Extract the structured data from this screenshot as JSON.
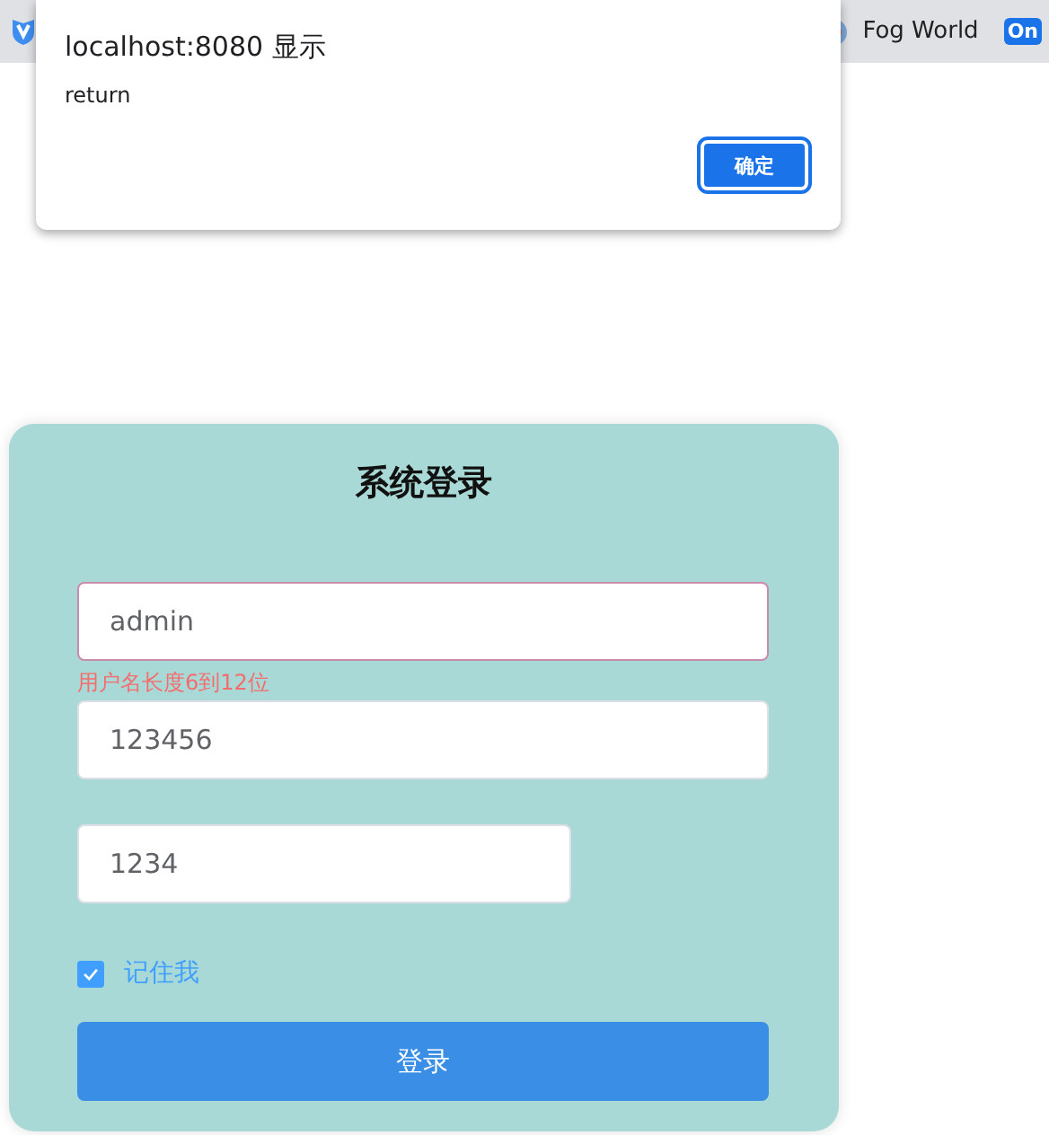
{
  "bookmark_bar": {
    "items": [
      {
        "kind": "shield"
      },
      {
        "kind": "site",
        "label": "Fog World"
      },
      {
        "kind": "badge",
        "label": "On"
      }
    ]
  },
  "dialog": {
    "title": "localhost:8080 显示",
    "message": "return",
    "button": "确定"
  },
  "login": {
    "title": "系统登录",
    "fields": [
      {
        "kind": "wide",
        "value": "admin",
        "invalid": true,
        "error": "用户名长度6到12位"
      },
      {
        "kind": "wide",
        "value": "123456",
        "invalid": false
      },
      {
        "kind": "narrow",
        "value": "1234",
        "invalid": false
      }
    ],
    "remember": {
      "label": "记住我",
      "checked": true
    },
    "button": "登录"
  }
}
